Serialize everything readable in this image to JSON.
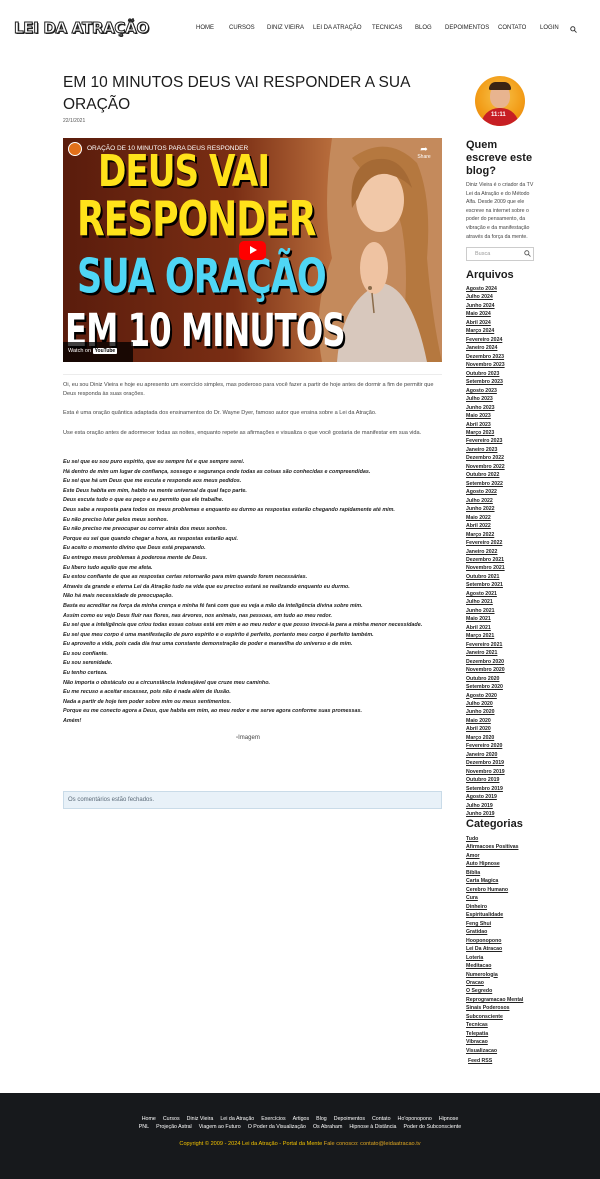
{
  "header": {
    "logo": "LEI DA ATRAÇÃO",
    "nav": [
      "HOME",
      "CURSOS",
      "DINIZ VIEIRA",
      "LEI DA ATRAÇÃO",
      "TECNICAS",
      "BLOG",
      "DEPOIMENTOS",
      "CONTATO",
      "LOGIN"
    ],
    "search_icon": "search-icon"
  },
  "post": {
    "title": "EM 10 MINUTOS DEUS VAI RESPONDER A SUA ORAÇÃO",
    "date": "22/1/2021",
    "video": {
      "title": "ORAÇÃO DE 10 MINUTOS PARA DEUS RESPONDER",
      "share_label": "Share",
      "watch_on": "Watch on",
      "youtube": "YouTube",
      "thumb_lines": [
        "DEUS VAI",
        "RESPONDER",
        "SUA ORAÇÃO",
        "EM 10 MINUTOS"
      ]
    },
    "paragraphs": [
      "Oi, eu sou Diniz Vieira e hoje eu apresento um exercício simples, mas poderoso para você fazer a partir de hoje antes de dormir a fim de permitir que Deus responda às suas orações.",
      "Esta é uma oração quântica adaptada dos ensinamentos do Dr. Wayne Dyer, famoso autor que ensina sobre a Lei da Atração.",
      "Use esta oração antes de adormecer todas as noites, enquanto repete as afirmações e visualiza o que você gostaria de manifestar em sua vida."
    ],
    "prayer": [
      "Eu sei que eu sou puro espírito, que eu sempre fui e que sempre serei.",
      "Há dentro de mim um lugar de confiança, sossego e segurança onde todas as coisas são conhecidas e compreendidas.",
      "Eu sei que há um Deus que me escuta e responde aos meus pedidos.",
      "Este Deus habita em mim, habito na mente universal da qual faço parte.",
      "Deus escuta tudo o que eu peço e eu permito que ele trabalhe.",
      "Deus sabe a resposta para todos os meus problemas e enquanto eu durmo as respostas estarão chegando rapidamente até mim.",
      "Eu não preciso lutar pelos meus sonhos.",
      "Eu não preciso me preocupar ou correr atrás dos meus sonhos.",
      "Porque eu sei que quando chegar a hora, as respostas estarão aqui.",
      "Eu aceito o momento divino que Deus está preparando.",
      "Eu entrego meus problemas à poderosa mente de Deus.",
      "Eu libero tudo aquilo que me afeta.",
      "Eu estou confiante de que as respostas certas retornarão para mim quando forem necessárias.",
      "Através da grande e eterna Lei da Atração tudo na vida que eu preciso estará se realizando enquanto eu durmo.",
      "Não há mais necessidade de preocupação.",
      "Basta eu acreditar na força da minha crença e minha fé fará com que eu veja a mão da inteligência divina sobre mim.",
      "Assim como eu vejo Deus fluir nas flores, nas árvores, nos animais, nas pessoas, em tudo ao meu redor.",
      "Eu sei que a inteligência que criou todas essas coisas está em mim e ao meu redor e que posso invocá-la para a minha menor necessidade.",
      "Eu sei que meu corpo é uma manifestação de puro espírito e o espírito é perfeito, portanto meu corpo é perfeito também.",
      "Eu aproveito a vida, pois cada dia traz uma constante demonstração de poder e maravilha do universo e de mim.",
      "Eu sou confiante.",
      "Eu sou serenidade.",
      "Eu tenho certeza.",
      "Não importa o obstáculo ou a circunstância indesejável que cruze meu caminho.",
      "Eu me recuso a aceitar escassez, pois não é nada além de ilusão.",
      "Nada a partir de hoje tem poder sobre mim ou meus sentimentos.",
      "Porque eu me conecto agora a Deus, que habita em mim, ao meu redor e me serve agora conforme suas promessas.",
      "Amém!"
    ],
    "image_alt": "Imagem",
    "comments_closed": "Os comentários estão fechados."
  },
  "sidebar": {
    "author_badge": "11:11",
    "about_title": "Quem escreve este blog?",
    "about_text": "Diniz Vieira é o criador da TV Lei da Atração e do Método Alfa. Desde 2009 que ele escreve na internet sobre o poder do pensamento, da vibração e da manifestação através da força da mente.",
    "search_placeholder": "Busca",
    "archives_title": "Arquivos",
    "archives": [
      "Agosto 2024",
      "Julho 2024",
      "Junho 2024",
      "Maio 2024",
      "Abril 2024",
      "Março 2024",
      "Fevereiro 2024",
      "Janeiro 2024",
      "Dezembro 2023",
      "Novembro 2023",
      "Outubro 2023",
      "Setembro 2023",
      "Agosto 2023",
      "Julho 2023",
      "Junho 2023",
      "Maio 2023",
      "Abril 2023",
      "Março 2023",
      "Fevereiro 2023",
      "Janeiro 2023",
      "Dezembro 2022",
      "Novembro 2022",
      "Outubro 2022",
      "Setembro 2022",
      "Agosto 2022",
      "Julho 2022",
      "Junho 2022",
      "Maio 2022",
      "Abril 2022",
      "Março 2022",
      "Fevereiro 2022",
      "Janeiro 2022",
      "Dezembro 2021",
      "Novembro 2021",
      "Outubro 2021",
      "Setembro 2021",
      "Agosto 2021",
      "Julho 2021",
      "Junho 2021",
      "Maio 2021",
      "Abril 2021",
      "Março 2021",
      "Fevereiro 2021",
      "Janeiro 2021",
      "Dezembro 2020",
      "Novembro 2020",
      "Outubro 2020",
      "Setembro 2020",
      "Agosto 2020",
      "Julho 2020",
      "Junho 2020",
      "Maio 2020",
      "Abril 2020",
      "Março 2020",
      "Fevereiro 2020",
      "Janeiro 2020",
      "Dezembro 2019",
      "Novembro 2019",
      "Outubro 2019",
      "Setembro 2019",
      "Agosto 2019",
      "Julho 2019",
      "Junho 2019"
    ],
    "categories_title": "Categorias",
    "categories": [
      "Tudo",
      "Afirmacoes Positivas",
      "Amor",
      "Auto Hipnose",
      "Biblia",
      "Carta Magica",
      "Cerebro Humano",
      "Cura",
      "Dinheiro",
      "Espiritualidade",
      "Feng Shui",
      "Gratidao",
      "Hooponopono",
      "Lei Da Atracao",
      "Loteria",
      "Meditacao",
      "Numerologia",
      "Oracao",
      "O Segredo",
      "Reprogramacao Mental",
      "Sinais Poderosos",
      "Subconsciente",
      "Tecnicas",
      "Telepatia",
      "Vibracao",
      "Visualizacao"
    ],
    "feed": "Feed RSS"
  },
  "footer": {
    "row1": [
      "Home",
      "Cursos",
      "Diniz Vieira",
      "Lei da Atração",
      "Exercícios",
      "Artigos",
      "Blog",
      "Depoimentos",
      "Contato",
      "Ho'oponopono",
      "Hipnose"
    ],
    "row2": [
      "PNL",
      "Projeção Astral",
      "Viagem ao Futuro",
      "O Poder da Visualização",
      "Os Abraham",
      "Hipnose à Distância",
      "Poder do Subconsciente"
    ],
    "copyright": "Copyright © 2009 - 2024 Lei da Atração - Portal da Mente",
    "contact": "Fale conosco: contato@leidaatracao.tv"
  }
}
